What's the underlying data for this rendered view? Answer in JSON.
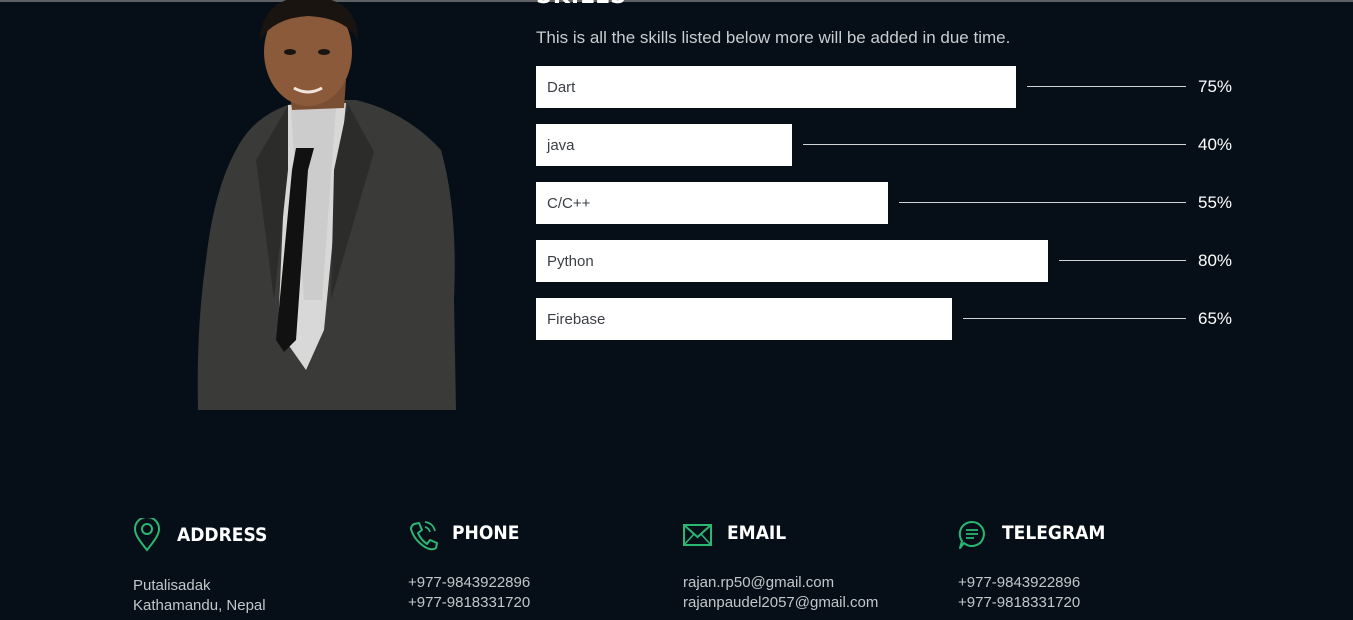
{
  "skills": {
    "heading": "SKILLS",
    "description": "This is all the skills listed below more will be added in due time.",
    "items": [
      {
        "name": "Dart",
        "percent_label": "75%",
        "value": 75
      },
      {
        "name": "java",
        "percent_label": "40%",
        "value": 40
      },
      {
        "name": "C/C++",
        "percent_label": "55%",
        "value": 55
      },
      {
        "name": "Python",
        "percent_label": "80%",
        "value": 80
      },
      {
        "name": "Firebase",
        "percent_label": "65%",
        "value": 65
      }
    ]
  },
  "contact": {
    "address": {
      "title": "ADDRESS",
      "line1": "Putalisadak",
      "line2": "Kathamandu, Nepal",
      "icon": "map-pin-icon"
    },
    "phone": {
      "title": "PHONE",
      "line1": "+977-9843922896",
      "line2": "+977-9818331720",
      "icon": "phone-icon"
    },
    "email": {
      "title": "EMAIL",
      "line1": "rajan.rp50@gmail.com",
      "line2": "rajanpaudel2057@gmail.com",
      "icon": "envelope-icon"
    },
    "telegram": {
      "title": "TELEGRAM",
      "line1": "+977-9843922896",
      "line2": "+977-9818331720",
      "icon": "chat-bubble-icon"
    }
  },
  "colors": {
    "background": "#060f17",
    "accent": "#2bb673",
    "bar": "#ffffff"
  }
}
